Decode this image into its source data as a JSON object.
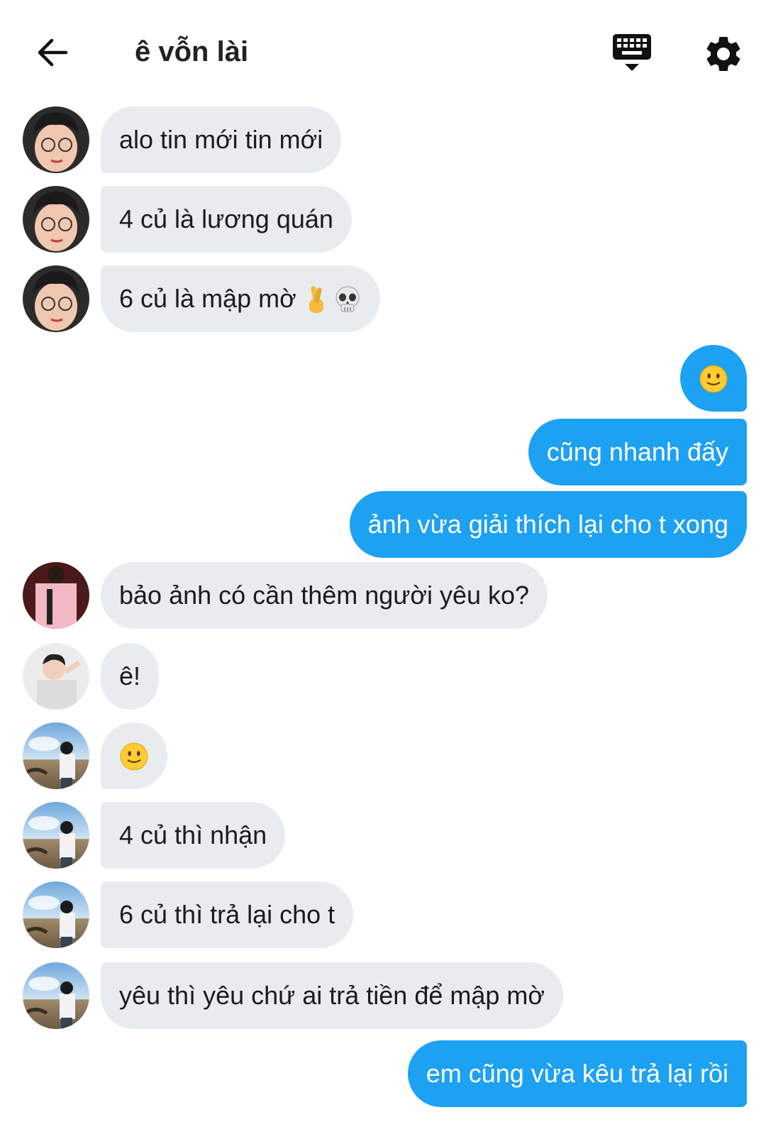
{
  "header": {
    "title": "ê vỗn lài",
    "back_icon": "arrow-left-icon",
    "keyboard_icon": "keyboard-hide-icon",
    "settings_icon": "gear-icon"
  },
  "messages": [
    {
      "dir": "in",
      "text": "alo tin mới tin mới"
    },
    {
      "dir": "in",
      "text": "4 củ là lương quán"
    },
    {
      "dir": "in",
      "text": "6 củ là mập mờ",
      "emojis": [
        "crossed-fingers",
        "skull"
      ]
    },
    {
      "dir": "out",
      "text": "",
      "emojis": [
        "slight-smile"
      ]
    },
    {
      "dir": "out",
      "text": "cũng nhanh đấy"
    },
    {
      "dir": "out",
      "text": "ảnh vừa giải thích lại cho t xong"
    },
    {
      "dir": "in",
      "text": "bảo ảnh có cần thêm người yêu ko?"
    },
    {
      "dir": "in",
      "text": "ê!"
    },
    {
      "dir": "in",
      "text": "",
      "emojis": [
        "slight-smile"
      ]
    },
    {
      "dir": "in",
      "text": "4 củ thì nhận"
    },
    {
      "dir": "in",
      "text": "6 củ thì trả lại cho t"
    },
    {
      "dir": "in",
      "text": "yêu thì yêu chứ ai trả tiền để mập mờ"
    },
    {
      "dir": "out",
      "text": "em cũng vừa kêu trả lại rồi"
    }
  ],
  "colors": {
    "incoming_bubble": "#e9ecef",
    "outgoing_bubble": "#1da1f2",
    "outgoing_text": "#ffffff",
    "incoming_text": "#1b1b1b"
  }
}
